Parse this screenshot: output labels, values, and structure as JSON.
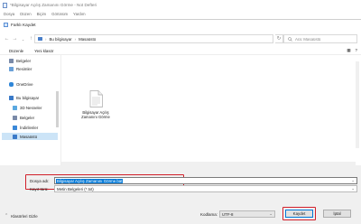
{
  "notepad": {
    "title": "*Bilgisayar Açılış Zamanını Görme - Not Defteri",
    "menu": [
      "Dosya",
      "Düzen",
      "Biçim",
      "Görünüm",
      "Yardım"
    ]
  },
  "dialog": {
    "title": "Farklı Kaydet",
    "breadcrumb": [
      "Bu bilgisayar",
      "Masaüstü"
    ],
    "search_placeholder": "Ara: Masaüstü",
    "toolbar": {
      "organize": "Düzenle",
      "new_folder": "Yeni klasör"
    },
    "sidebar": [
      {
        "label": "Belgeler",
        "icon": "documents-icon",
        "color": "#7a8aa8"
      },
      {
        "label": "Resimler",
        "icon": "pictures-icon",
        "color": "#6aa0d8"
      },
      {
        "label": "OneDrive",
        "icon": "onedrive-icon",
        "color": "#2f86d8"
      },
      {
        "label": "Bu bilgisayar",
        "icon": "computer-icon",
        "color": "#3a7ac8"
      },
      {
        "label": "3D Nesneler",
        "icon": "3d-objects-icon",
        "color": "#5aa8e0"
      },
      {
        "label": "Belgeler",
        "icon": "documents-icon",
        "color": "#7a8aa8"
      },
      {
        "label": "İndirilenler",
        "icon": "downloads-icon",
        "color": "#3a88d8"
      },
      {
        "label": "Masaüstü",
        "icon": "desktop-icon",
        "color": "#3a7ac8",
        "selected": true
      }
    ],
    "file": {
      "name": "Bilgisayar Açılış Zamanını Görme"
    },
    "form": {
      "filename_label": "Dosya adı:",
      "filename_value": "Bilgisayar Açılış Zamanını Görme.bat",
      "type_label": "Kayıt türü:",
      "type_value": "Metin Belgeleri (*.txt)",
      "hide_folders": "Klasörleri Gizle",
      "encoding_label": "Kodlama:",
      "encoding_value": "UTF-8",
      "save": "Kaydet",
      "cancel": "İptal"
    },
    "highlight_color": "#d11f2a"
  }
}
